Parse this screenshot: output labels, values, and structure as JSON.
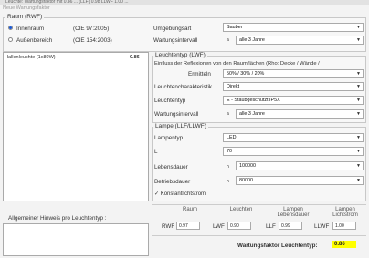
{
  "window": {
    "top_text": "Leuchte: Wartungsfaktor mit 0.86 ... (LLF) 0.98 LLWF 1.00 ...",
    "title": "Neue Wartungsfaktor"
  },
  "room": {
    "group_label": "Raum (RWF)",
    "option_inside": "Innenraum",
    "option_inside_std": "(CIE 97:2005)",
    "option_outside": "Außenbereich",
    "option_outside_std": "(CIE 154:2003)",
    "env_label": "Umgebungsart",
    "env_value": "Sauber",
    "interval_label": "Wartungsintervall",
    "interval_unit": "a",
    "interval_value": "alle 3 Jahre"
  },
  "luminaire_list": [
    {
      "name": "Hallenleuchte (1x80W)",
      "value": "0.86"
    }
  ],
  "luminaire_type": {
    "group_label": "Leuchtentyp (LWF)",
    "reflection_text": "Einfluss der Reflexionen von den Raumflächen (Rho: Decke / Wände /",
    "determine_label": "Ermitteln",
    "reflection_value": "50% / 30% / 20%",
    "charact_label": "Leuchtencharakteristik",
    "charact_value": "Direkt",
    "type_label": "Leuchtentyp",
    "type_value": "E - Staubgeschützt IP5X",
    "interval_label": "Wartungsintervall",
    "interval_unit": "a",
    "interval_value": "alle 3 Jahre"
  },
  "lamp": {
    "group_label": "Lampe (LLF/LLWF)",
    "type_label": "Lampentyp",
    "type_value": "LED",
    "l_label": "L",
    "l_value": "70",
    "life_label": "Lebensdauer",
    "life_unit": "h",
    "life_value": "100000",
    "op_label": "Betriebsdauer",
    "op_unit": "h",
    "op_value": "80000",
    "constant_label": "Konstantlichtstrom"
  },
  "summary": {
    "hint_label": "Allgemeiner Hinweis pro Leuchtentyp :",
    "headers": [
      "Raum",
      "Leuchten",
      "Lampen Lebensdauer",
      "Lampen Lichtstrom"
    ],
    "rwf_label": "RWF",
    "rwf_value": "0.97",
    "lwf_label": "LWF",
    "lwf_value": "0.90",
    "llf_label": "LLF",
    "llf_value": "0.99",
    "llwf_label": "LLWF",
    "llwf_value": "1.00",
    "total_label": "Wartungsfaktor Leuchtentyp:",
    "total_value": "0.86"
  }
}
